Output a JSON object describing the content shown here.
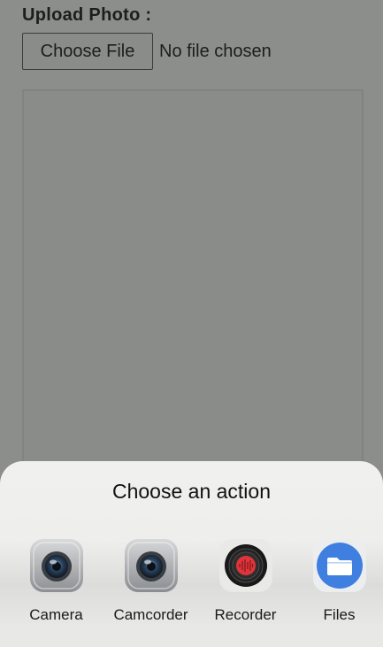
{
  "form": {
    "upload_label": "Upload Photo :",
    "choose_file_label": "Choose File",
    "file_status": "No file chosen"
  },
  "sheet": {
    "title": "Choose an action",
    "actions": [
      {
        "label": "Camera",
        "icon": "camera-icon"
      },
      {
        "label": "Camcorder",
        "icon": "camcorder-icon"
      },
      {
        "label": "Recorder",
        "icon": "recorder-icon"
      },
      {
        "label": "Files",
        "icon": "files-icon"
      }
    ]
  },
  "colors": {
    "overlay_background": "#8c8e8b",
    "sheet_background": "#f0f0ee",
    "files_accent": "#3f7fe0",
    "recorder_accent": "#e0343a"
  }
}
